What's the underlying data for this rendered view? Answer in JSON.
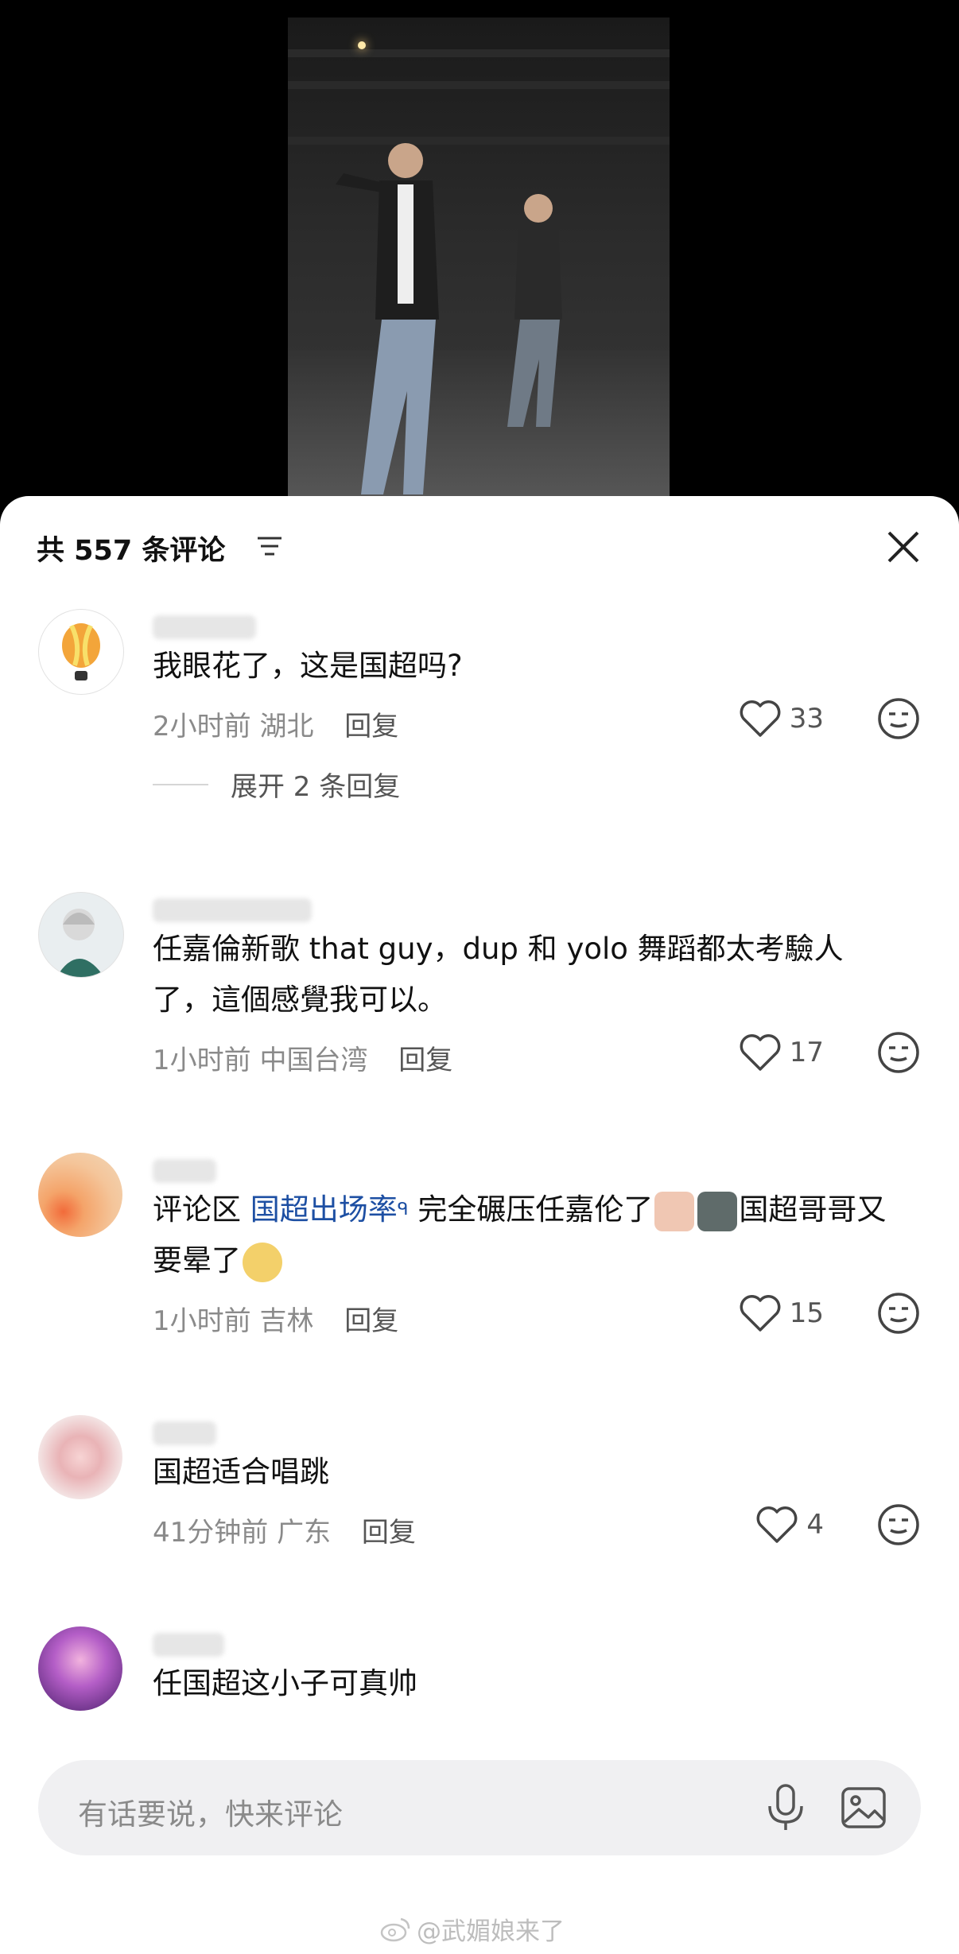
{
  "header": {
    "title": "共 557 条评论"
  },
  "comments": [
    {
      "text": "我眼花了，这是国超吗?",
      "time": "2小时前",
      "location": "湖北",
      "reply_label": "回复",
      "likes": "33",
      "expand_label": "展开 2 条回复"
    },
    {
      "text": "任嘉倫新歌 that guy，dup 和 yolo 舞蹈都太考驗人了，這個感覺我可以。",
      "time": "1小时前",
      "location": "中国台湾",
      "reply_label": "回复",
      "likes": "17"
    },
    {
      "text_before": "评论区",
      "link": "国超出场率",
      "text_middle": "完全碾压任嘉伦了",
      "text_after": "国超哥哥又要晕了",
      "time": "1小时前",
      "location": "吉林",
      "reply_label": "回复",
      "likes": "15"
    },
    {
      "text": "国超适合唱跳",
      "time": "41分钟前",
      "location": "广东",
      "reply_label": "回复",
      "likes": "4"
    },
    {
      "text": "任国超这小子可真帅"
    }
  ],
  "input": {
    "placeholder": "有话要说，快来评论"
  },
  "watermark": "@武媚娘来了",
  "colors": {
    "link": "#1d4fa3",
    "meta": "#8a8a8a",
    "input_bg": "#f0f0f2"
  }
}
